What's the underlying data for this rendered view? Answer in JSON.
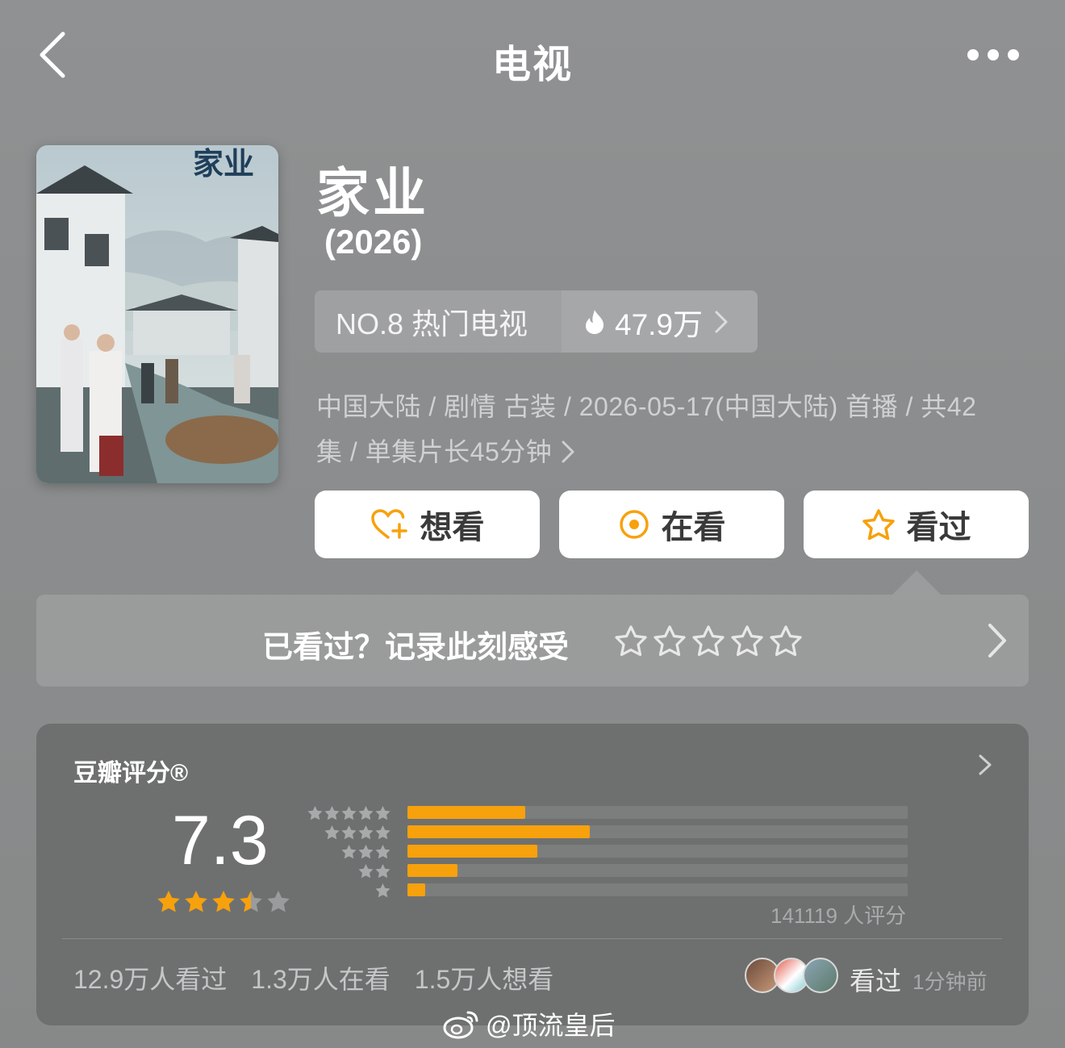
{
  "nav": {
    "title": "电视"
  },
  "show": {
    "title": "家业",
    "year": "(2026)",
    "poster": {
      "title_text": "家业"
    },
    "rank": {
      "label": "NO.8 热门电视",
      "heat": "47.9万"
    },
    "meta_line1": "中国大陆 / 剧情 古装 / 2026-05-17(中国大陆) 首播 / 共42",
    "meta_line2": "集 / 单集片长45分钟"
  },
  "actions": {
    "want": "想看",
    "watching": "在看",
    "watched": "看过"
  },
  "rate_prompt": {
    "text": "已看过？记录此刻感受",
    "stars": 5
  },
  "douban": {
    "title": "豆瓣评分®",
    "score": "7.3",
    "score_stars": 3.5,
    "distribution": [
      {
        "stars": 5,
        "percent": 23.5
      },
      {
        "stars": 4,
        "percent": 36.5
      },
      {
        "stars": 3,
        "percent": 26.0
      },
      {
        "stars": 2,
        "percent": 10.0
      },
      {
        "stars": 1,
        "percent": 3.5
      }
    ],
    "votes": "141119 人评分",
    "stats": {
      "watched": "12.9万人看过",
      "watching": "1.3万人在看",
      "want": "1.5万人想看"
    },
    "activity": {
      "text": "看过",
      "time": "1分钟前"
    }
  },
  "colors": {
    "accent": "#f7a10c",
    "card": "#6e7070"
  },
  "watermark": "@顶流皇后"
}
